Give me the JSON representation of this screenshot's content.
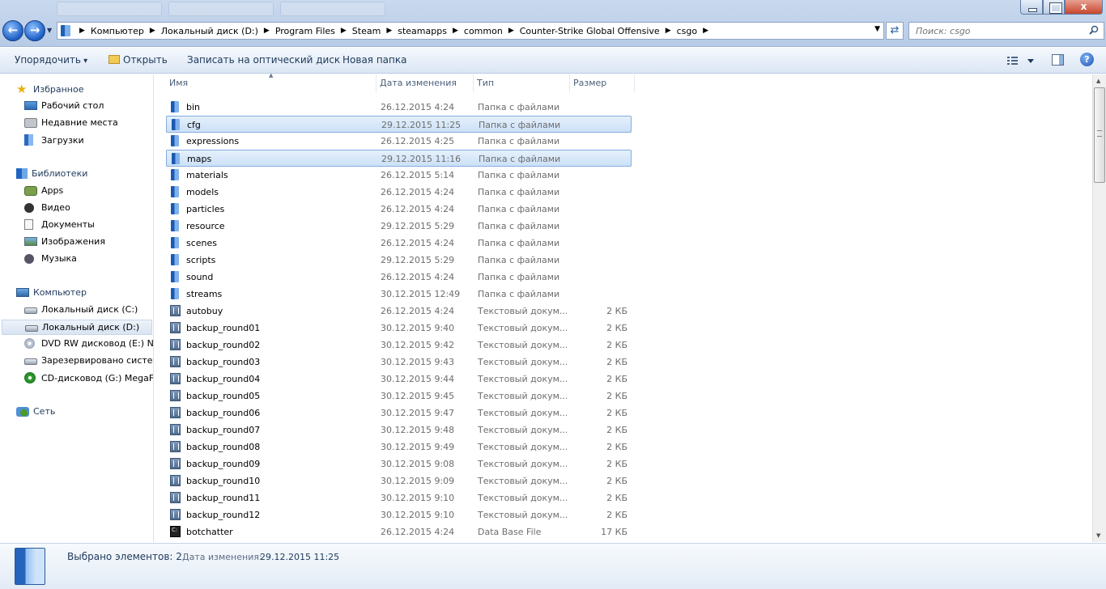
{
  "window": {
    "close_label": "x"
  },
  "address": {
    "crumbs": [
      "Компьютер",
      "Локальный диск (D:)",
      "Program Files",
      "Steam",
      "steamapps",
      "common",
      "Counter-Strike Global Offensive",
      "csgo"
    ]
  },
  "search": {
    "placeholder": "Поиск: csgo"
  },
  "toolbar": {
    "organize": "Упорядочить",
    "open": "Открыть",
    "burn": "Записать на оптический диск",
    "new_folder": "Новая папка",
    "help": "?"
  },
  "navpane": {
    "favorites": {
      "label": "Избранное",
      "items": [
        "Рабочий стол",
        "Недавние места",
        "Загрузки"
      ]
    },
    "libraries": {
      "label": "Библиотеки",
      "items": [
        "Apps",
        "Видео",
        "Документы",
        "Изображения",
        "Музыка"
      ]
    },
    "computer": {
      "label": "Компьютер",
      "items": [
        "Локальный диск (C:)",
        "Локальный диск (D:)",
        "DVD RW дисковод (E:) Nev",
        "Зарезервировано систем",
        "CD-дисковод (G:) MegaFc"
      ]
    },
    "network": {
      "label": "Сеть"
    }
  },
  "columns": {
    "name": "Имя",
    "date": "Дата изменения",
    "type": "Тип",
    "size": "Размер"
  },
  "files": [
    {
      "name": "bin",
      "date": "26.12.2015 4:24",
      "type": "Папка с файлами",
      "size": "",
      "kind": "folder",
      "selected": false
    },
    {
      "name": "cfg",
      "date": "29.12.2015 11:25",
      "type": "Папка с файлами",
      "size": "",
      "kind": "folder",
      "selected": true
    },
    {
      "name": "expressions",
      "date": "26.12.2015 4:25",
      "type": "Папка с файлами",
      "size": "",
      "kind": "folder",
      "selected": false
    },
    {
      "name": "maps",
      "date": "29.12.2015 11:16",
      "type": "Папка с файлами",
      "size": "",
      "kind": "folder",
      "selected": true
    },
    {
      "name": "materials",
      "date": "26.12.2015 5:14",
      "type": "Папка с файлами",
      "size": "",
      "kind": "folder",
      "selected": false
    },
    {
      "name": "models",
      "date": "26.12.2015 4:24",
      "type": "Папка с файлами",
      "size": "",
      "kind": "folder",
      "selected": false
    },
    {
      "name": "particles",
      "date": "26.12.2015 4:24",
      "type": "Папка с файлами",
      "size": "",
      "kind": "folder",
      "selected": false
    },
    {
      "name": "resource",
      "date": "29.12.2015 5:29",
      "type": "Папка с файлами",
      "size": "",
      "kind": "folder",
      "selected": false
    },
    {
      "name": "scenes",
      "date": "26.12.2015 4:24",
      "type": "Папка с файлами",
      "size": "",
      "kind": "folder",
      "selected": false
    },
    {
      "name": "scripts",
      "date": "29.12.2015 5:29",
      "type": "Папка с файлами",
      "size": "",
      "kind": "folder",
      "selected": false
    },
    {
      "name": "sound",
      "date": "26.12.2015 4:24",
      "type": "Папка с файлами",
      "size": "",
      "kind": "folder",
      "selected": false
    },
    {
      "name": "streams",
      "date": "30.12.2015 12:49",
      "type": "Папка с файлами",
      "size": "",
      "kind": "folder",
      "selected": false
    },
    {
      "name": "autobuy",
      "date": "26.12.2015 4:24",
      "type": "Текстовый докум...",
      "size": "2 КБ",
      "kind": "text",
      "selected": false
    },
    {
      "name": "backup_round01",
      "date": "30.12.2015 9:40",
      "type": "Текстовый докум...",
      "size": "2 КБ",
      "kind": "text",
      "selected": false
    },
    {
      "name": "backup_round02",
      "date": "30.12.2015 9:42",
      "type": "Текстовый докум...",
      "size": "2 КБ",
      "kind": "text",
      "selected": false
    },
    {
      "name": "backup_round03",
      "date": "30.12.2015 9:43",
      "type": "Текстовый докум...",
      "size": "2 КБ",
      "kind": "text",
      "selected": false
    },
    {
      "name": "backup_round04",
      "date": "30.12.2015 9:44",
      "type": "Текстовый докум...",
      "size": "2 КБ",
      "kind": "text",
      "selected": false
    },
    {
      "name": "backup_round05",
      "date": "30.12.2015 9:45",
      "type": "Текстовый докум...",
      "size": "2 КБ",
      "kind": "text",
      "selected": false
    },
    {
      "name": "backup_round06",
      "date": "30.12.2015 9:47",
      "type": "Текстовый докум...",
      "size": "2 КБ",
      "kind": "text",
      "selected": false
    },
    {
      "name": "backup_round07",
      "date": "30.12.2015 9:48",
      "type": "Текстовый докум...",
      "size": "2 КБ",
      "kind": "text",
      "selected": false
    },
    {
      "name": "backup_round08",
      "date": "30.12.2015 9:49",
      "type": "Текстовый докум...",
      "size": "2 КБ",
      "kind": "text",
      "selected": false
    },
    {
      "name": "backup_round09",
      "date": "30.12.2015 9:08",
      "type": "Текстовый докум...",
      "size": "2 КБ",
      "kind": "text",
      "selected": false
    },
    {
      "name": "backup_round10",
      "date": "30.12.2015 9:09",
      "type": "Текстовый докум...",
      "size": "2 КБ",
      "kind": "text",
      "selected": false
    },
    {
      "name": "backup_round11",
      "date": "30.12.2015 9:10",
      "type": "Текстовый докум...",
      "size": "2 КБ",
      "kind": "text",
      "selected": false
    },
    {
      "name": "backup_round12",
      "date": "30.12.2015 9:10",
      "type": "Текстовый докум...",
      "size": "2 КБ",
      "kind": "text",
      "selected": false
    },
    {
      "name": "botchatter",
      "date": "26.12.2015 4:24",
      "type": "Data Base File",
      "size": "17 КБ",
      "kind": "db",
      "selected": false
    }
  ],
  "details": {
    "count_label": "Выбрано элементов: 2",
    "date_label": "Дата изменения:",
    "date_value": "29.12.2015 11:25"
  },
  "colors": {
    "accent": "#1e395b",
    "selection": "#cce1f8"
  }
}
